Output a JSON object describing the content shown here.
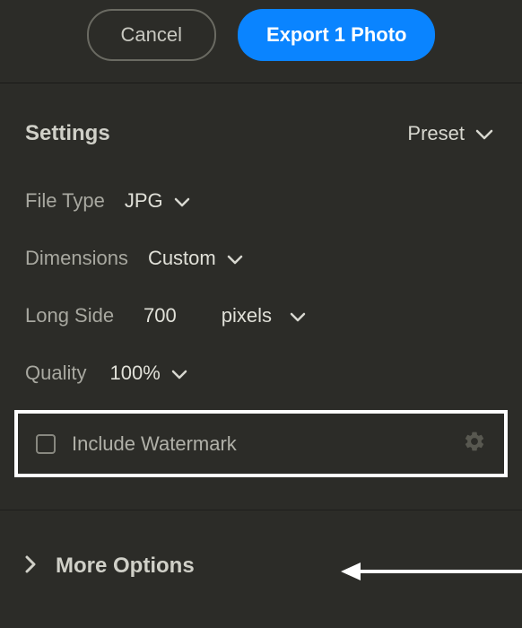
{
  "topbar": {
    "cancel_label": "Cancel",
    "export_label": "Export 1 Photo"
  },
  "header": {
    "settings_label": "Settings",
    "preset_label": "Preset"
  },
  "fields": {
    "file_type_label": "File Type",
    "file_type_value": "JPG",
    "dimensions_label": "Dimensions",
    "dimensions_value": "Custom",
    "long_side_label": "Long Side",
    "long_side_value": "700",
    "units_value": "pixels",
    "quality_label": "Quality",
    "quality_value": "100%",
    "watermark_label": "Include Watermark"
  },
  "footer": {
    "more_options_label": "More Options"
  }
}
